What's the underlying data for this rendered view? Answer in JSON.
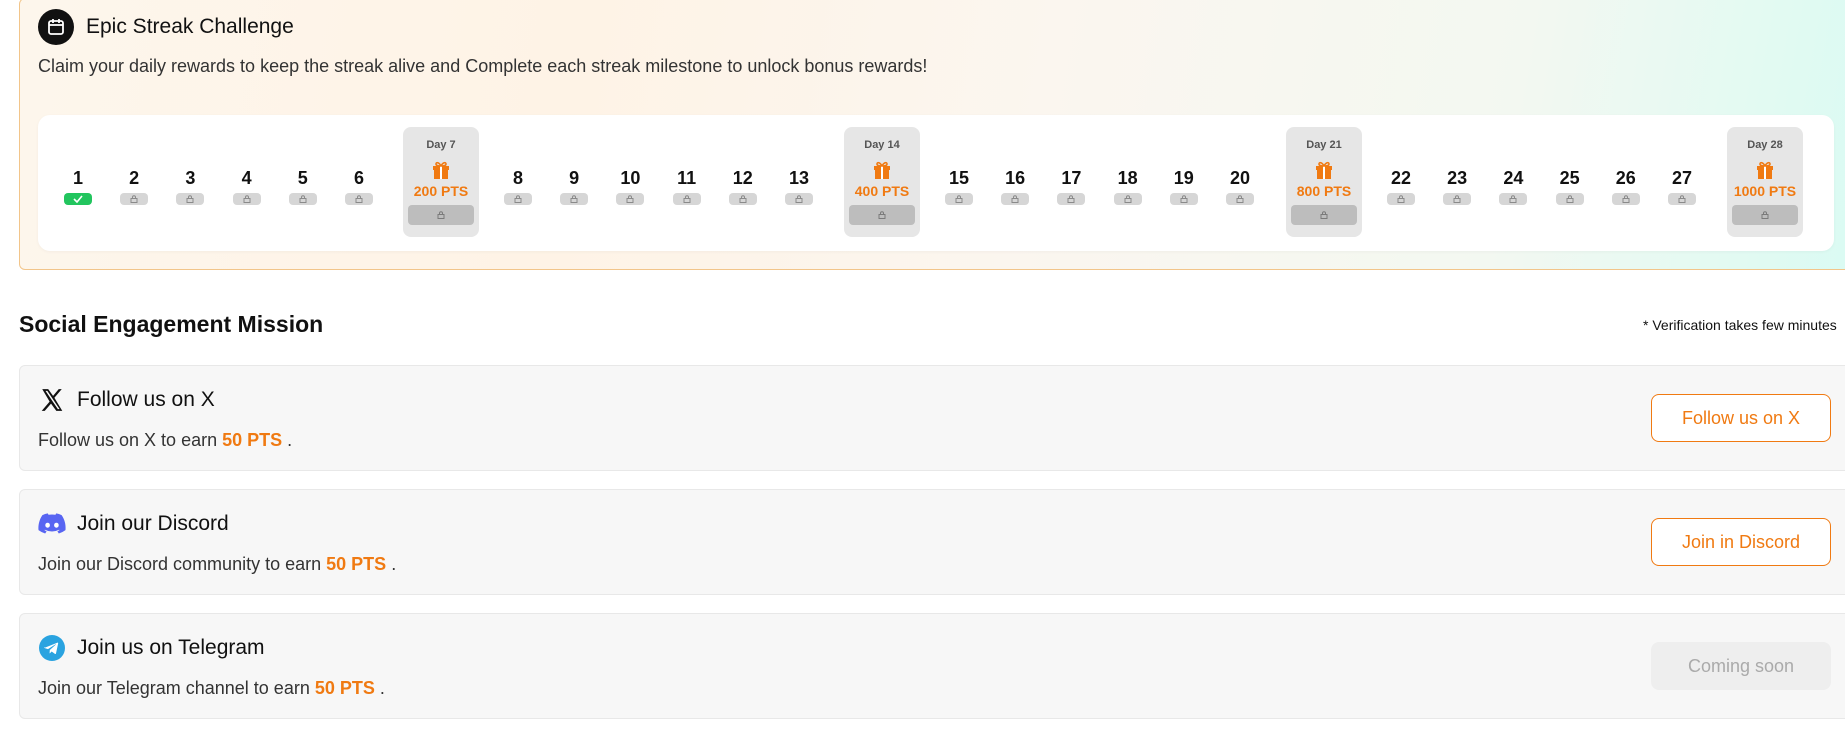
{
  "streak": {
    "title": "Epic Streak Challenge",
    "description": "Claim your daily rewards to keep the streak alive and Complete each streak milestone to unlock bonus rewards!",
    "icon": "calendar-icon",
    "days": [
      "1",
      "2",
      "3",
      "4",
      "5",
      "6",
      "8",
      "9",
      "10",
      "11",
      "12",
      "13",
      "15",
      "16",
      "17",
      "18",
      "19",
      "20",
      "22",
      "23",
      "24",
      "25",
      "26",
      "27"
    ],
    "completed_days": [
      "1"
    ],
    "milestones": [
      {
        "label": "Day 7",
        "points": "200 PTS"
      },
      {
        "label": "Day 14",
        "points": "400 PTS"
      },
      {
        "label": "Day 21",
        "points": "800 PTS"
      },
      {
        "label": "Day 28",
        "points": "1000 PTS"
      }
    ]
  },
  "social": {
    "title": "Social Engagement Mission",
    "note": "* Verification takes few minutes",
    "missions": [
      {
        "icon": "x-logo-icon",
        "title": "Follow us on X",
        "desc_prefix": "Follow us on X to earn",
        "points": "50 PTS",
        "desc_suffix": ".",
        "button": "Follow us on X",
        "enabled": true
      },
      {
        "icon": "discord-icon",
        "title": "Join our Discord",
        "desc_prefix": "Join our Discord community to earn",
        "points": "50 PTS",
        "desc_suffix": ".",
        "button": "Join in Discord",
        "enabled": true
      },
      {
        "icon": "telegram-icon",
        "title": "Join us on Telegram",
        "desc_prefix": "Join our Telegram channel to earn",
        "points": "50 PTS",
        "desc_suffix": ".",
        "button": "Coming soon",
        "enabled": false
      }
    ]
  },
  "colors": {
    "accent": "#f07a12",
    "success": "#22c55e",
    "discord": "#5865f2",
    "telegram": "#2aa3e0"
  }
}
